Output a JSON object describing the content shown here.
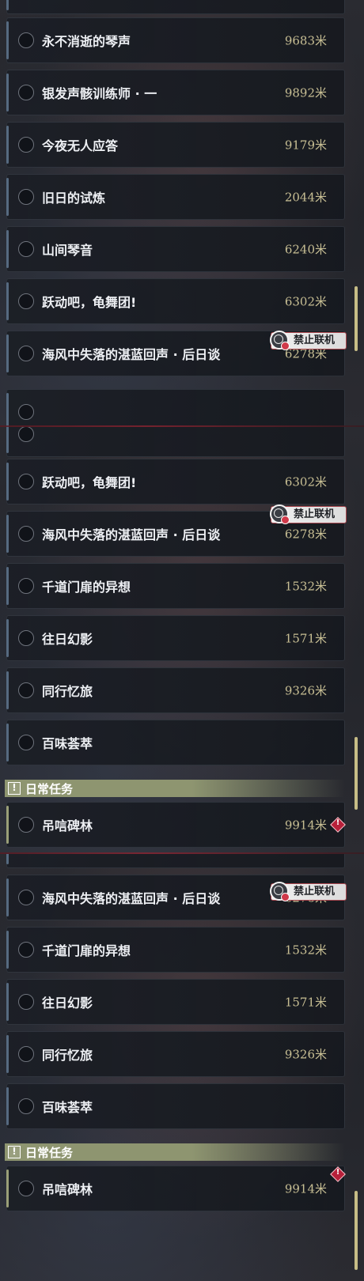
{
  "quests": [
    {
      "name": "永不消逝的琴声",
      "distance": "9683米"
    },
    {
      "name": "银发声骸训练师 · 一",
      "distance": "9892米"
    },
    {
      "name": "今夜无人应答",
      "distance": "9179米"
    },
    {
      "name": "旧日的试炼",
      "distance": "2044米"
    },
    {
      "name": "山间琴音",
      "distance": "6240米"
    },
    {
      "name": "跃动吧，龟舞团!",
      "distance": "6302米"
    },
    {
      "name": "海风中失落的湛蓝回声 · 后日谈",
      "distance": "6278米"
    },
    {
      "name": "千道门扉的异想",
      "distance": "1532米"
    },
    {
      "name": "往日幻影",
      "distance": "1571米"
    },
    {
      "name": "同行忆旅",
      "distance": "9326米"
    },
    {
      "name": "百味荟萃",
      "distance": ""
    },
    {
      "name": "吊唁碑林",
      "distance": "9914米"
    }
  ],
  "badge": {
    "label": "禁止联机"
  },
  "section": {
    "title": "日常任务",
    "icon": "!"
  },
  "colors": {
    "distance": "#c8bf94",
    "badge_border": "#a8464e",
    "section_bg": "#8e9570",
    "alert": "#b8203a",
    "scrollbar": "#c7bd86"
  }
}
